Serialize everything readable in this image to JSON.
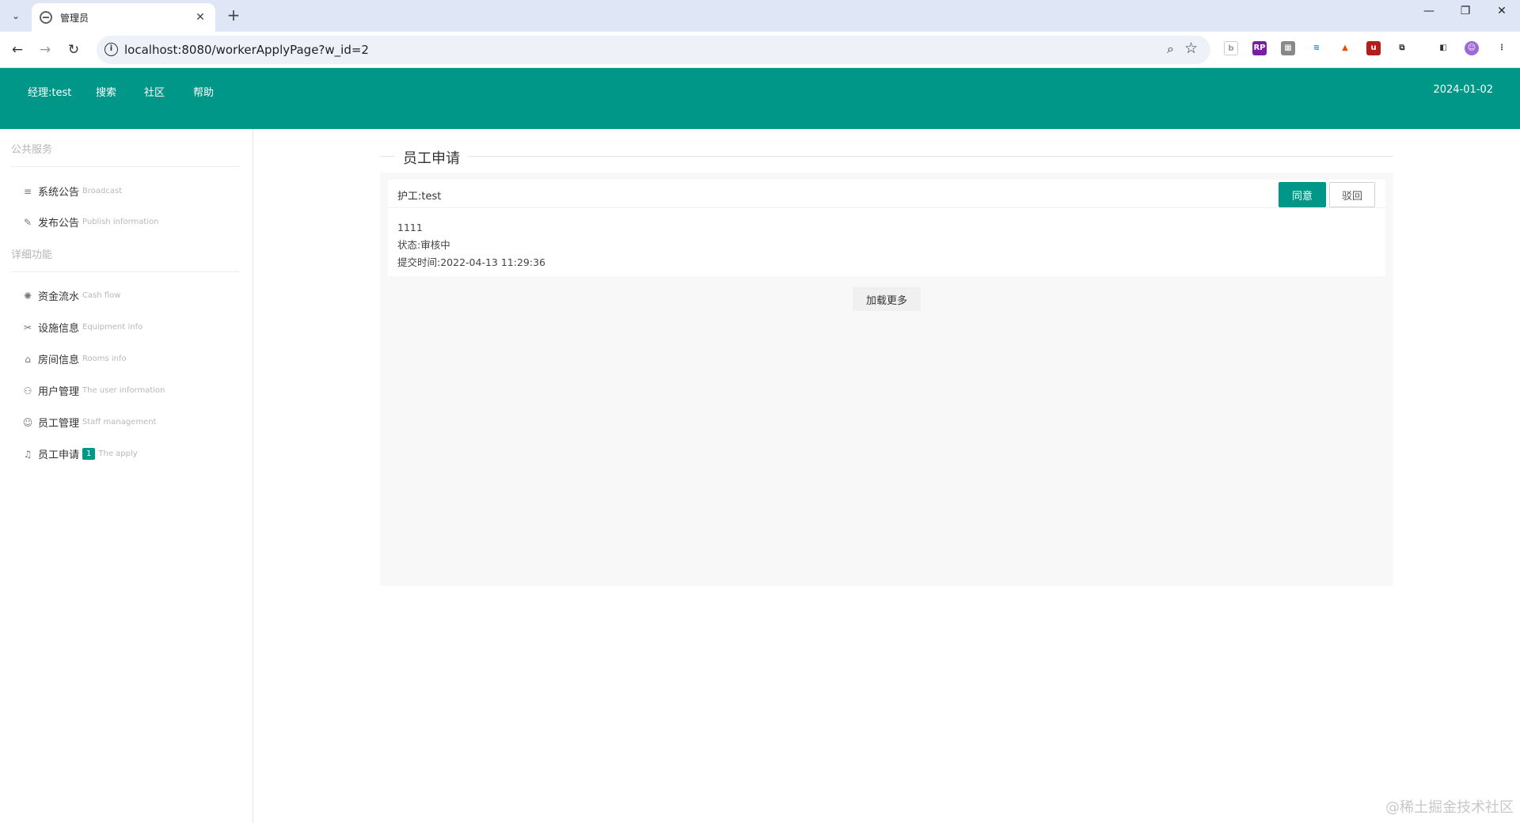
{
  "browser": {
    "tab_title": "管理员",
    "url": "localhost:8080/workerApplyPage?w_id=2"
  },
  "header": {
    "nav": [
      "经理:test",
      "搜索",
      "社区",
      "帮助"
    ],
    "date": "2024-01-02"
  },
  "sidebar": {
    "group1": "公共服务",
    "group2": "详细功能",
    "items": [
      {
        "label": "系统公告",
        "en": "Broadcast",
        "icon": "list-icon"
      },
      {
        "label": "发布公告",
        "en": "Publish information",
        "icon": "edit-icon"
      },
      {
        "label": "资金流水",
        "en": "Cash flow",
        "icon": "sun-icon"
      },
      {
        "label": "设施信息",
        "en": "Equipment info",
        "icon": "tools-icon"
      },
      {
        "label": "房间信息",
        "en": "Rooms info",
        "icon": "home-icon"
      },
      {
        "label": "用户管理",
        "en": "The user information",
        "icon": "users-icon"
      },
      {
        "label": "员工管理",
        "en": "Staff management",
        "icon": "user-icon"
      },
      {
        "label": "员工申请",
        "en": "The apply",
        "icon": "bell-icon",
        "badge": "1"
      }
    ]
  },
  "main": {
    "legend": "员工申请",
    "application": {
      "title": "护工:test",
      "agree_label": "同意",
      "reject_label": "驳回",
      "content": "1111",
      "status": "状态:审核中",
      "submit_time": "提交时间:2022-04-13 11:29:36"
    },
    "load_more": "加载更多"
  },
  "watermark": "@稀土掘金技术社区",
  "colors": {
    "primary": "#009688"
  }
}
